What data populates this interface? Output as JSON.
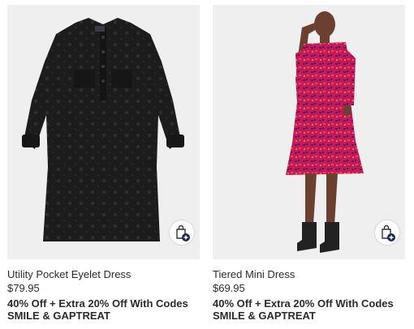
{
  "products": [
    {
      "name": "Utility Pocket Eyelet Dress",
      "price": "$79.95",
      "promo_line1": "40% Off + Extra 20% Off With Codes",
      "promo_line2": "SMILE & GAPTREAT",
      "image_bg": "#efefef",
      "dress_color": "#1c1c1c",
      "add_to_bag_icon": "shopping-bag-plus-icon"
    },
    {
      "name": "Tiered Mini Dress",
      "price": "$69.95",
      "promo_line1": "40% Off + Extra 20% Off With Codes",
      "promo_line2": "SMILE & GAPTREAT",
      "image_bg": "#efefef",
      "dress_color": "#c4195a",
      "add_to_bag_icon": "shopping-bag-plus-icon"
    }
  ]
}
